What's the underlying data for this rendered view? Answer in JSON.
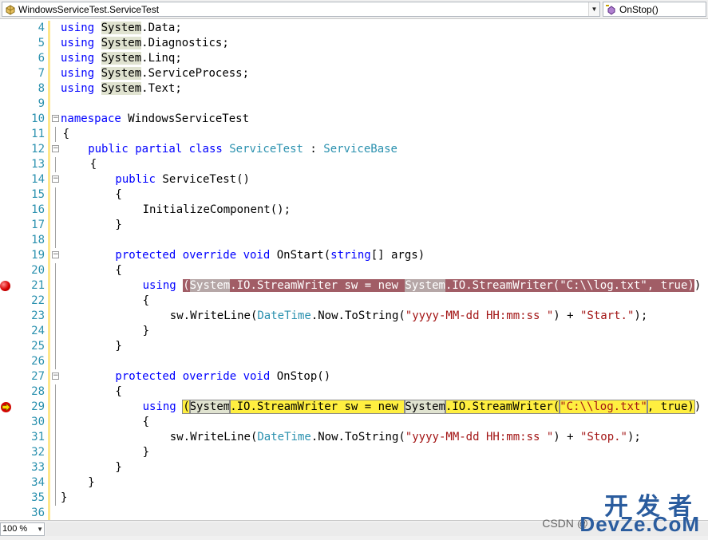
{
  "nav": {
    "class_combo": "WindowsServiceTest.ServiceTest",
    "member_combo": "OnStop()"
  },
  "zoom": "100 %",
  "lines": [
    {
      "n": "4",
      "segs": [
        [
          "kw",
          "using"
        ],
        [
          "t",
          " "
        ],
        [
          "sys",
          "System"
        ],
        [
          "t",
          ".Data;"
        ]
      ]
    },
    {
      "n": "5",
      "segs": [
        [
          "kw",
          "using"
        ],
        [
          "t",
          " "
        ],
        [
          "sys",
          "System"
        ],
        [
          "t",
          ".Diagnostics;"
        ]
      ]
    },
    {
      "n": "6",
      "segs": [
        [
          "kw",
          "using"
        ],
        [
          "t",
          " "
        ],
        [
          "sys",
          "System"
        ],
        [
          "t",
          ".Linq;"
        ]
      ]
    },
    {
      "n": "7",
      "segs": [
        [
          "kw",
          "using"
        ],
        [
          "t",
          " "
        ],
        [
          "sys",
          "System"
        ],
        [
          "t",
          ".ServiceProcess;"
        ]
      ]
    },
    {
      "n": "8",
      "segs": [
        [
          "kw",
          "using"
        ],
        [
          "t",
          " "
        ],
        [
          "sys",
          "System"
        ],
        [
          "t",
          ".Text;"
        ]
      ]
    },
    {
      "n": "9",
      "segs": []
    },
    {
      "n": "10",
      "segs": [
        [
          "kw",
          "namespace"
        ],
        [
          "t",
          " WindowsServiceTest"
        ]
      ]
    },
    {
      "n": "11",
      "segs": [
        [
          "t",
          "{"
        ]
      ]
    },
    {
      "n": "12",
      "segs": [
        [
          "kw",
          "public"
        ],
        [
          "t",
          " "
        ],
        [
          "kw",
          "partial"
        ],
        [
          "t",
          " "
        ],
        [
          "kw",
          "class"
        ],
        [
          "t",
          " "
        ],
        [
          "ty",
          "ServiceTest"
        ],
        [
          "t",
          " : "
        ],
        [
          "ty",
          "ServiceBase"
        ]
      ]
    },
    {
      "n": "13",
      "segs": [
        [
          "t",
          "{"
        ]
      ]
    },
    {
      "n": "14",
      "segs": [
        [
          "kw",
          "public"
        ],
        [
          "t",
          " ServiceTest()"
        ]
      ]
    },
    {
      "n": "15",
      "segs": [
        [
          "t",
          "{"
        ]
      ]
    },
    {
      "n": "16",
      "segs": [
        [
          "t",
          "InitializeComponent();"
        ]
      ]
    },
    {
      "n": "17",
      "segs": [
        [
          "t",
          "}"
        ]
      ]
    },
    {
      "n": "18",
      "segs": []
    },
    {
      "n": "19",
      "segs": [
        [
          "kw",
          "protected"
        ],
        [
          "t",
          " "
        ],
        [
          "kw",
          "override"
        ],
        [
          "t",
          " "
        ],
        [
          "kw",
          "void"
        ],
        [
          "t",
          " OnStart("
        ],
        [
          "kw",
          "string"
        ],
        [
          "t",
          "[] args)"
        ]
      ]
    },
    {
      "n": "20",
      "segs": [
        [
          "t",
          "{"
        ]
      ]
    },
    {
      "n": "21",
      "segs": [
        [
          "kw",
          "using"
        ],
        [
          "t",
          " "
        ],
        [
          "hlbp",
          "("
        ],
        [
          "hlbpsys",
          "System"
        ],
        [
          "hlbp",
          ".IO.StreamWriter sw = new "
        ],
        [
          "hlbpsys",
          "System"
        ],
        [
          "hlbp",
          ".IO.StreamWriter(\"C:\\\\log.txt\", true)"
        ],
        [
          "t",
          ")"
        ]
      ]
    },
    {
      "n": "22",
      "segs": [
        [
          "t",
          "{"
        ]
      ]
    },
    {
      "n": "23",
      "segs": [
        [
          "t",
          "sw.WriteLine("
        ],
        [
          "ty",
          "DateTime"
        ],
        [
          "t",
          ".Now.ToString("
        ],
        [
          "str",
          "\"yyyy-MM-dd HH:mm:ss \""
        ],
        [
          "t",
          ") + "
        ],
        [
          "str",
          "\"Start.\""
        ],
        [
          "t",
          ");"
        ]
      ]
    },
    {
      "n": "24",
      "segs": [
        [
          "t",
          "}"
        ]
      ]
    },
    {
      "n": "25",
      "segs": [
        [
          "t",
          "}"
        ]
      ]
    },
    {
      "n": "26",
      "segs": []
    },
    {
      "n": "27",
      "segs": [
        [
          "kw",
          "protected"
        ],
        [
          "t",
          " "
        ],
        [
          "kw",
          "override"
        ],
        [
          "t",
          " "
        ],
        [
          "kw",
          "void"
        ],
        [
          "t",
          " OnStop()"
        ]
      ]
    },
    {
      "n": "28",
      "segs": [
        [
          "t",
          "{"
        ]
      ]
    },
    {
      "n": "29",
      "segs": [
        [
          "kw",
          "using"
        ],
        [
          "t",
          " "
        ],
        [
          "hlcur",
          "("
        ],
        [
          "hlcursys",
          "System"
        ],
        [
          "hlcur",
          ".IO.StreamWriter sw = new "
        ],
        [
          "hlcursys",
          "System"
        ],
        [
          "hlcur",
          ".IO.StreamWriter("
        ],
        [
          "hlcurstr",
          "\"C:\\\\log.txt\""
        ],
        [
          "hlcur",
          ", true)"
        ],
        [
          "t",
          ")"
        ]
      ]
    },
    {
      "n": "30",
      "segs": [
        [
          "t",
          "{"
        ]
      ]
    },
    {
      "n": "31",
      "segs": [
        [
          "t",
          "sw.WriteLine("
        ],
        [
          "ty",
          "DateTime"
        ],
        [
          "t",
          ".Now.ToString("
        ],
        [
          "str",
          "\"yyyy-MM-dd HH:mm:ss \""
        ],
        [
          "t",
          ") + "
        ],
        [
          "str",
          "\"Stop.\""
        ],
        [
          "t",
          ");"
        ]
      ]
    },
    {
      "n": "32",
      "segs": [
        [
          "t",
          "}"
        ]
      ]
    },
    {
      "n": "33",
      "segs": [
        [
          "t",
          "}"
        ]
      ]
    },
    {
      "n": "34",
      "segs": [
        [
          "t",
          "}"
        ]
      ]
    },
    {
      "n": "35",
      "segs": [
        [
          "t",
          "}"
        ]
      ]
    },
    {
      "n": "36",
      "segs": []
    }
  ],
  "watermark": {
    "cn": "开发者",
    "en": "DevZe.CoM",
    "csdn": "CSDN @"
  },
  "colors": {
    "keyword": "#0000ff",
    "type": "#2b91af",
    "string": "#a31515",
    "line_number": "#2b91af",
    "breakpoint_highlight": "#a15d66",
    "current_statement": "#ffef40"
  }
}
